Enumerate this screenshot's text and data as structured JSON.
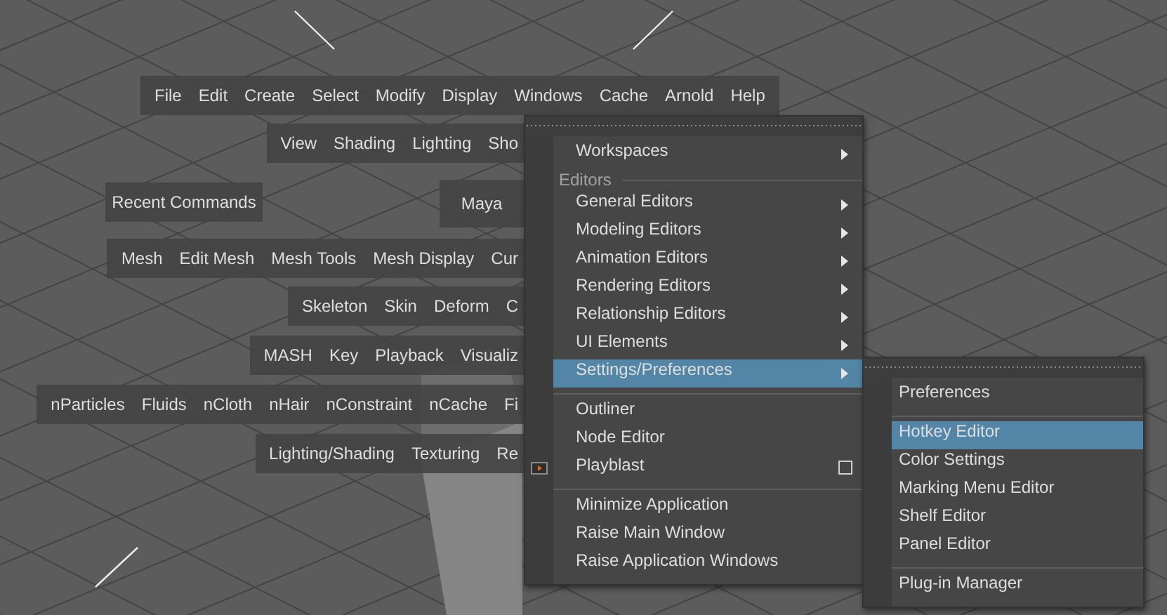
{
  "hotbox": {
    "rows": [
      {
        "items": [
          "File",
          "Edit",
          "Create",
          "Select",
          "Modify",
          "Display",
          "Windows",
          "Cache",
          "Arnold",
          "Help"
        ]
      },
      {
        "items": [
          "View",
          "Shading",
          "Lighting",
          "Sho"
        ]
      },
      {
        "items": [
          "Mesh",
          "Edit Mesh",
          "Mesh Tools",
          "Mesh Display",
          "Cur"
        ]
      },
      {
        "items": [
          "Skeleton",
          "Skin",
          "Deform",
          "C"
        ]
      },
      {
        "items": [
          "MASH",
          "Key",
          "Playback",
          "Visualiz"
        ]
      },
      {
        "items": [
          "nParticles",
          "Fluids",
          "nCloth",
          "nHair",
          "nConstraint",
          "nCache",
          "Fi"
        ]
      },
      {
        "items": [
          "Lighting/Shading",
          "Texturing",
          "Re"
        ]
      }
    ],
    "recent_commands": "Recent Commands",
    "center_label": "Maya"
  },
  "menu": {
    "items": [
      {
        "kind": "item",
        "label": "Workspaces",
        "submenu": true,
        "selected": false
      },
      {
        "kind": "section",
        "label": "Editors"
      },
      {
        "kind": "item",
        "label": "General Editors",
        "submenu": true,
        "selected": false
      },
      {
        "kind": "item",
        "label": "Modeling Editors",
        "submenu": true,
        "selected": false
      },
      {
        "kind": "item",
        "label": "Animation Editors",
        "submenu": true,
        "selected": false
      },
      {
        "kind": "item",
        "label": "Rendering Editors",
        "submenu": true,
        "selected": false
      },
      {
        "kind": "item",
        "label": "Relationship Editors",
        "submenu": true,
        "selected": false
      },
      {
        "kind": "item",
        "label": "UI Elements",
        "submenu": true,
        "selected": false
      },
      {
        "kind": "item",
        "label": "Settings/Preferences",
        "submenu": true,
        "selected": true
      },
      {
        "kind": "separator"
      },
      {
        "kind": "item",
        "label": "Outliner",
        "submenu": false,
        "selected": false
      },
      {
        "kind": "item",
        "label": "Node Editor",
        "submenu": false,
        "selected": false
      },
      {
        "kind": "item",
        "label": "Playblast",
        "submenu": false,
        "selected": false,
        "icon": true,
        "checked": false
      },
      {
        "kind": "separator"
      },
      {
        "kind": "item",
        "label": "Minimize Application",
        "submenu": false,
        "selected": false
      },
      {
        "kind": "item",
        "label": "Raise Main Window",
        "submenu": false,
        "selected": false
      },
      {
        "kind": "item",
        "label": "Raise Application Windows",
        "submenu": false,
        "selected": false
      }
    ]
  },
  "submenu": {
    "items": [
      {
        "kind": "item",
        "label": "Preferences",
        "submenu": false,
        "selected": false
      },
      {
        "kind": "separator"
      },
      {
        "kind": "item",
        "label": "Hotkey Editor",
        "submenu": false,
        "selected": true
      },
      {
        "kind": "item",
        "label": "Color Settings",
        "submenu": false,
        "selected": false
      },
      {
        "kind": "item",
        "label": "Marking Menu Editor",
        "submenu": false,
        "selected": false
      },
      {
        "kind": "item",
        "label": "Shelf Editor",
        "submenu": false,
        "selected": false
      },
      {
        "kind": "item",
        "label": "Panel Editor",
        "submenu": false,
        "selected": false
      },
      {
        "kind": "separator"
      },
      {
        "kind": "item",
        "label": "Plug-in Manager",
        "submenu": false,
        "selected": false
      }
    ]
  }
}
